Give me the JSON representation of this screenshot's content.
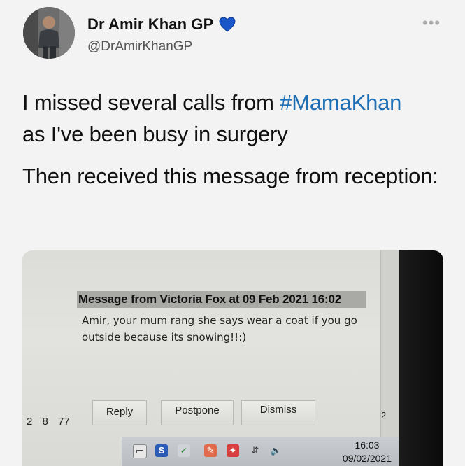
{
  "author": {
    "name": "Dr Amir Khan GP",
    "handle": "@DrAmirKhanGP",
    "badge_icon": "blue-heart-icon",
    "more_icon": "more-options-icon"
  },
  "tweet": {
    "line1_pre": "I missed several calls from ",
    "hashtag": "#MamaKhan",
    "line1_post": "as I've been busy in surgery",
    "para2": "Then received this message from reception:"
  },
  "screenshot": {
    "message_header": "Message from Victoria Fox at 09 Feb 2021 16:02",
    "message_line1": "Amir, your mum rang she says wear a coat if you go",
    "message_line2": "outside because its snowing!!:)",
    "left_numbers": "2 8 77",
    "buttons": {
      "reply": "Reply",
      "postpone": "Postpone",
      "dismiss": "Dismiss"
    },
    "scroll_number": "2",
    "clock_time": "16:03",
    "clock_date": "09/02/2021"
  },
  "colors": {
    "hashtag": "#1d6fb5",
    "heart": "#1a56c8"
  }
}
